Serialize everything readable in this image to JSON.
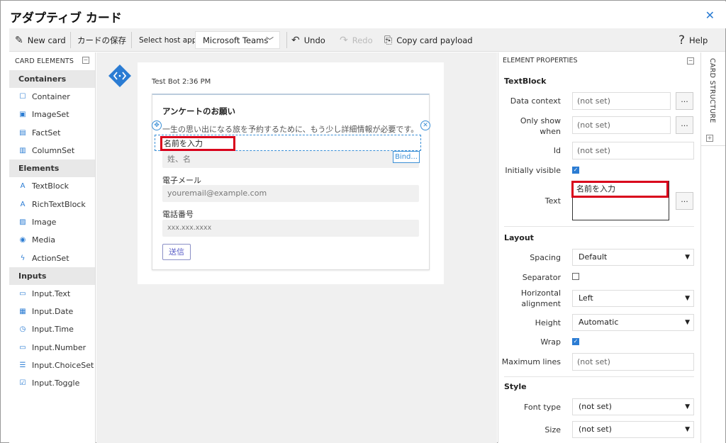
{
  "window": {
    "title": "アダプティブ カード",
    "close_icon": "close-icon"
  },
  "toolbar": {
    "new_card": "New card",
    "save_card": "カードの保存",
    "host_label": "Select host app:",
    "host_value": "Microsoft Teams",
    "undo": "Undo",
    "redo": "Redo",
    "copy_payload": "Copy card payload",
    "help": "Help"
  },
  "card_elements": {
    "header": "CARD ELEMENTS",
    "groups": [
      {
        "name": "Containers",
        "items": [
          "Container",
          "ImageSet",
          "FactSet",
          "ColumnSet"
        ]
      },
      {
        "name": "Elements",
        "items": [
          "TextBlock",
          "RichTextBlock",
          "Image",
          "Media",
          "ActionSet"
        ]
      },
      {
        "name": "Inputs",
        "items": [
          "Input.Text",
          "Input.Date",
          "Input.Time",
          "Input.Number",
          "Input.ChoiceSet",
          "Input.Toggle"
        ]
      }
    ]
  },
  "preview": {
    "bot_line": "Test Bot 2:36 PM",
    "card_title": "アンケートのお願い",
    "description": "一生の思い出になる旅を予約するために、もう少し詳細情報が必要です。",
    "name_label": "名前を入力",
    "name_placeholder": "姓、名",
    "bind_button": "Bind...",
    "email_label": "電子メール",
    "email_placeholder": "youremail@example.com",
    "phone_label": "電話番号",
    "phone_placeholder": "xxx.xxx.xxxx",
    "submit": "送信"
  },
  "properties": {
    "header": "ELEMENT PROPERTIES",
    "section_textblock": "TextBlock",
    "data_context_label": "Data context",
    "data_context_value": "(not set)",
    "only_show_label": "Only show when",
    "only_show_value": "(not set)",
    "id_label": "Id",
    "id_value": "(not set)",
    "initially_visible_label": "Initially visible",
    "initially_visible": true,
    "text_label": "Text",
    "text_value": "名前を入力",
    "dots": "...",
    "section_layout": "Layout",
    "spacing_label": "Spacing",
    "spacing_value": "Default",
    "separator_label": "Separator",
    "separator": false,
    "halign_label": "Horizontal alignment",
    "halign_value": "Left",
    "height_label": "Height",
    "height_value": "Automatic",
    "wrap_label": "Wrap",
    "wrap": true,
    "max_lines_label": "Maximum lines",
    "max_lines_value": "(not set)",
    "section_style": "Style",
    "font_type_label": "Font type",
    "font_type_value": "(not set)",
    "size_label": "Size",
    "size_value": "(not set)"
  },
  "card_structure": {
    "label": "CARD STRUCTURE"
  },
  "colors": {
    "accent": "#2b7cd3",
    "highlight": "#d9001b",
    "teams_purple": "#5b5fc7"
  }
}
